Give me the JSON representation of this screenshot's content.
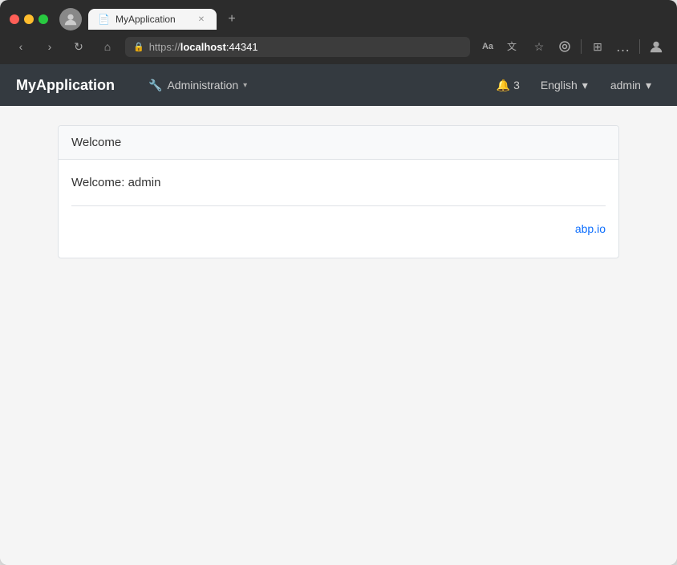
{
  "browser": {
    "url_protocol": "https://",
    "url_host": "localhost",
    "url_port": ":44341",
    "url_full": "https://localhost:44341",
    "tab_title": "MyApplication",
    "tab_favicon": "📄"
  },
  "app": {
    "brand": "MyApplication",
    "nav": {
      "administration_label": "Administration",
      "administration_icon": "🔧",
      "caret": "▾"
    },
    "notifications": {
      "icon": "🔔",
      "count": "3"
    },
    "language": {
      "label": "English",
      "caret": "▾"
    },
    "user": {
      "label": "admin",
      "caret": "▾"
    }
  },
  "page": {
    "card_header": "Welcome",
    "welcome_message": "Welcome: admin",
    "footer_link_text": "abp.io",
    "footer_link_url": "https://abp.io"
  },
  "toolbar": {
    "back": "‹",
    "forward": "›",
    "reload": "↻",
    "home": "⌂",
    "search": "🔍",
    "read": "Aa",
    "star": "☆",
    "extensions": "🧩",
    "favorites": "⊞",
    "more": "…",
    "profile": "👤"
  }
}
